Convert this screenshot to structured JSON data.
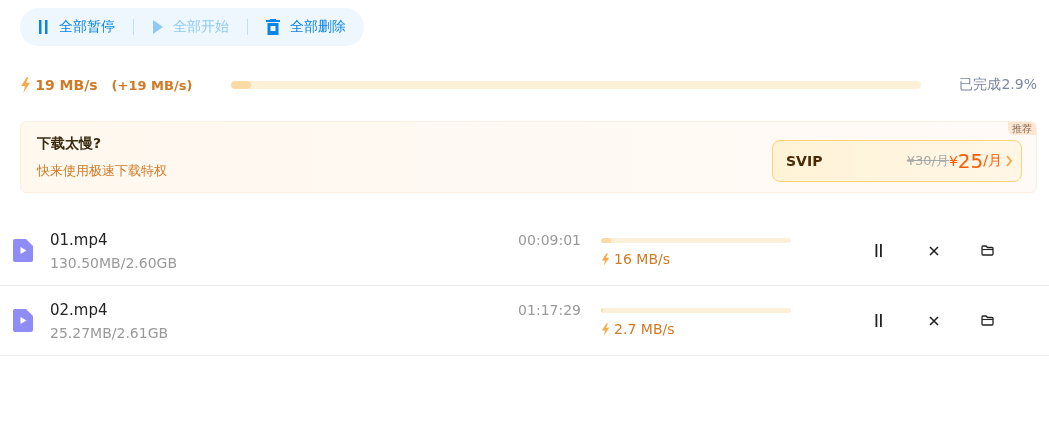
{
  "toolbar": [
    {
      "kind": "pause",
      "label": "全部暂停",
      "disabled": false
    },
    {
      "kind": "start",
      "label": "全部开始",
      "disabled": true
    },
    {
      "kind": "delete",
      "label": "全部删除",
      "disabled": false
    }
  ],
  "speed": {
    "current": "19 MB/s",
    "boost": "(+19 MB/s)",
    "level": 0.029,
    "completed": "已完成2.9%"
  },
  "promo": {
    "title": "下载太慢?",
    "subtitle": "快来使用极速下载特权",
    "badge": "推荐",
    "plan": "SVIP",
    "old_price": "¥30/月",
    "currency": "¥",
    "price": "25",
    "unit": "/月"
  },
  "downloads": [
    {
      "name": "01.mp4",
      "size": "130.50MB/2.60GB",
      "remaining": "00:09:01",
      "level": 0.05,
      "speed": "16 MB/s"
    },
    {
      "name": "02.mp4",
      "size": "25.27MB/2.61GB",
      "remaining": "01:17:29",
      "level": 0.01,
      "speed": "2.7 MB/s"
    }
  ]
}
